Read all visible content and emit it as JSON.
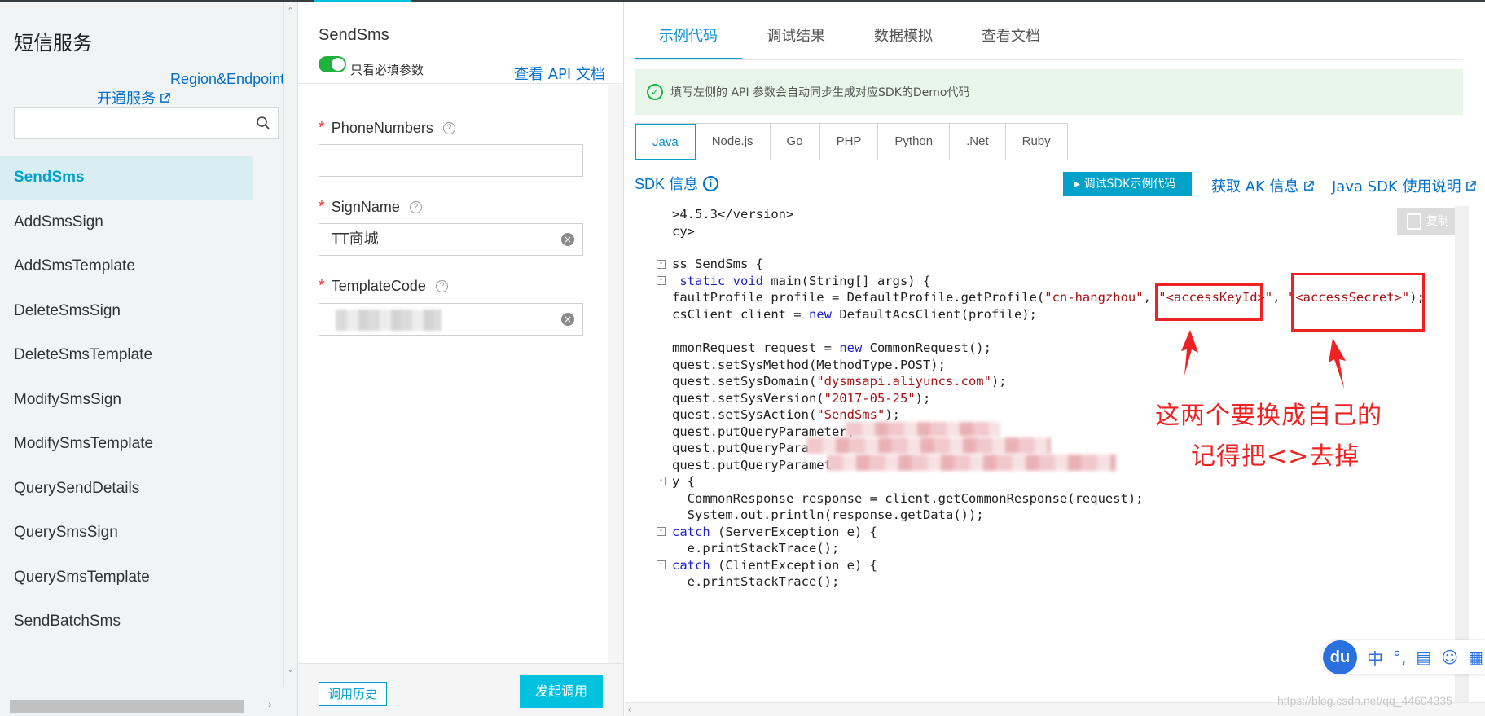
{
  "sidebar": {
    "title": "短信服务",
    "region_link": "Region&Endpoint",
    "open_service_link": "开通服务",
    "search_placeholder": "",
    "items": [
      {
        "label": "SendSms"
      },
      {
        "label": "AddSmsSign"
      },
      {
        "label": "AddSmsTemplate"
      },
      {
        "label": "DeleteSmsSign"
      },
      {
        "label": "DeleteSmsTemplate"
      },
      {
        "label": "ModifySmsSign"
      },
      {
        "label": "ModifySmsTemplate"
      },
      {
        "label": "QuerySendDetails"
      },
      {
        "label": "QuerySmsSign"
      },
      {
        "label": "QuerySmsTemplate"
      },
      {
        "label": "SendBatchSms"
      }
    ]
  },
  "form": {
    "title": "SendSms",
    "toggle_label": "只看必填参数",
    "api_doc_link": "查看 API 文档",
    "fields": [
      {
        "label": "PhoneNumbers",
        "value": ""
      },
      {
        "label": "SignName",
        "value": "TT商城"
      },
      {
        "label": "TemplateCode",
        "value": ""
      }
    ],
    "history_button": "调用历史",
    "invoke_button": "发起调用"
  },
  "right": {
    "tabs": [
      {
        "label": "示例代码"
      },
      {
        "label": "调试结果"
      },
      {
        "label": "数据模拟"
      },
      {
        "label": "查看文档"
      }
    ],
    "notice": "填写左侧的 API 参数会自动同步生成对应SDK的Demo代码",
    "languages": [
      "Java",
      "Node.js",
      "Go",
      "PHP",
      "Python",
      ".Net",
      "Ruby"
    ],
    "sdk_info": "SDK 信息",
    "debug_button": "调试SDK示例代码",
    "ak_link": "获取 AK 信息",
    "java_sdk_link": "Java SDK 使用说明",
    "copy_button": "复制"
  },
  "code": {
    "l1": ">4.5.3</version>",
    "l2": "cy>",
    "l3": "ss SendSms {",
    "l4a": " static void",
    "l4b": " main(String[] args) {",
    "l5a": "faultProfile profile = DefaultProfile.getProfile(",
    "l5b": "\"cn-hangzhou\"",
    "l5c": ", ",
    "l5d": "\"<accessKeyId>\"",
    "l5e": ", ",
    "l5f": "\"<accessSecret>\"",
    "l5g": ");",
    "l6a": "csClient client = ",
    "l6b": "new",
    "l6c": " DefaultAcsClient(profile);",
    "l7a": "mmonRequest request = ",
    "l7b": "new",
    "l7c": " CommonRequest();",
    "l8": "quest.setSysMethod(MethodType.POST);",
    "l9a": "quest.setSysDomain(",
    "l9b": "\"dysmsapi.aliyuncs.com\"",
    "l9c": ");",
    "l10a": "quest.setSysVersion(",
    "l10b": "\"2017-05-25\"",
    "l10c": ");",
    "l11a": "quest.setSysAction(",
    "l11b": "\"SendSms\"",
    "l11c": ");",
    "l12": "quest.putQueryParameter(",
    "l13": "quest.putQueryPara",
    "l14": "quest.putQueryParamet",
    "l15": "y {",
    "l16": "  CommonResponse response = client.getCommonResponse(request);",
    "l17": "  System.out.println(response.getData());",
    "l18a": "catch",
    "l18b": " (ServerException e) {",
    "l19": "  e.printStackTrace();",
    "l20a": "catch",
    "l20b": " (ClientException e) {",
    "l21": "  e.printStackTrace();"
  },
  "annotation": {
    "line1": "这两个要换成自己的",
    "line2": "记得把<>去掉"
  },
  "ime": {
    "logo": "du",
    "cn": "中"
  },
  "watermark": "https://blog.csdn.net/qq_44604335"
}
